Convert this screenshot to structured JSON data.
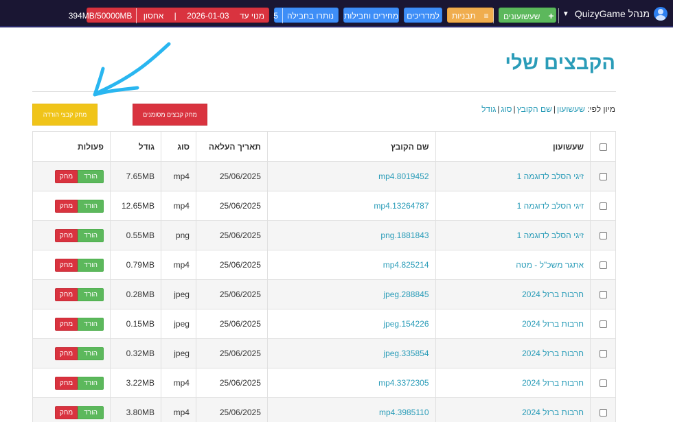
{
  "topbar": {
    "brand_label": "מנהל QuizyGame",
    "buttons": {
      "games": "שעשועונים",
      "templates": "תבניות",
      "guides": "למדריכים",
      "pricing": "מחירים וחבילות",
      "remaining_label": "נותרו בחבילה",
      "remaining_count": "5",
      "subscription_label": "מנוי עד",
      "subscription_date": "2026-01-03",
      "storage_label": "אחסון",
      "storage_value": "394MB/50000MB"
    }
  },
  "page": {
    "title": "הקבצים שלי",
    "sort_label": "מיון לפי:",
    "sort_options": [
      "שעשועון",
      "שם הקובץ",
      "סוג",
      "גודל"
    ],
    "delete_downloaded_label": "מחק קבצי הורדה",
    "delete_marked_label": "מחק קבצים מסומנים"
  },
  "table": {
    "headers": {
      "game": "שעשועון",
      "file_name": "שם הקובץ",
      "upload_date": "תאריך העלאה",
      "type": "סוג",
      "size": "גודל",
      "actions": "פעולות"
    },
    "download_label": "הורד",
    "delete_label": "מחק",
    "rows": [
      {
        "game": "זיגי הסלב לדוגמה 1",
        "file": "mp4.8019452",
        "date": "25/06/2025",
        "type": "mp4",
        "size": "7.65MB"
      },
      {
        "game": "זיגי הסלב לדוגמה 1",
        "file": "mp4.13264787",
        "date": "25/06/2025",
        "type": "mp4",
        "size": "12.65MB"
      },
      {
        "game": "זיגי הסלב לדוגמה 1",
        "file": "png.1881843",
        "date": "25/06/2025",
        "type": "png",
        "size": "0.55MB"
      },
      {
        "game": "אתגר משכ\"ל - מטה",
        "file": "mp4.825214",
        "date": "25/06/2025",
        "type": "mp4",
        "size": "0.79MB"
      },
      {
        "game": "חרבות ברזל 2024",
        "file": "jpeg.288845",
        "date": "25/06/2025",
        "type": "jpeg",
        "size": "0.28MB"
      },
      {
        "game": "חרבות ברזל 2024",
        "file": "jpeg.154226",
        "date": "25/06/2025",
        "type": "jpeg",
        "size": "0.15MB"
      },
      {
        "game": "חרבות ברזל 2024",
        "file": "jpeg.335854",
        "date": "25/06/2025",
        "type": "jpeg",
        "size": "0.32MB"
      },
      {
        "game": "חרבות ברזל 2024",
        "file": "mp4.3372305",
        "date": "25/06/2025",
        "type": "mp4",
        "size": "3.22MB"
      },
      {
        "game": "חרבות ברזל 2024",
        "file": "mp4.3985110",
        "date": "25/06/2025",
        "type": "mp4",
        "size": "3.80MB"
      }
    ]
  },
  "colors": {
    "topbar_bg": "#1a1633",
    "accent_title": "#2a9cb8",
    "green": "#5cb85c",
    "red": "#d9333f",
    "yellow": "#f0c419",
    "blue": "#3e8ef7",
    "annotation_arrow": "#29b6f0"
  }
}
